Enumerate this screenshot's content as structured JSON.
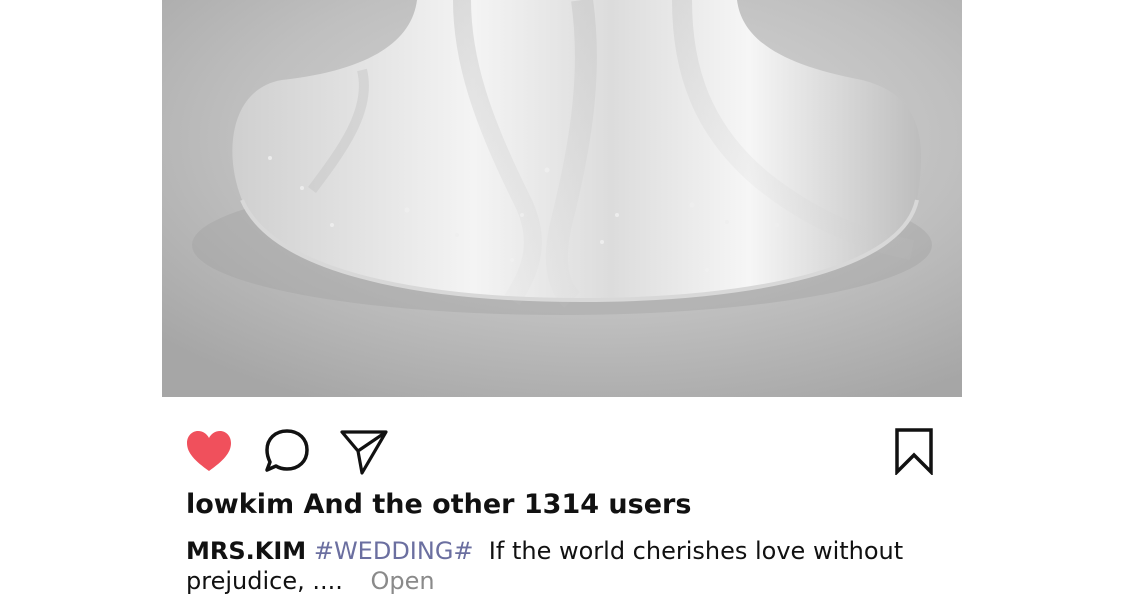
{
  "post": {
    "photo": {
      "description_icon": "wedding-dress-train-photo"
    },
    "actions": {
      "like": {
        "icon": "heart-icon",
        "color": "#f0505c",
        "liked": true
      },
      "comment": {
        "icon": "comment-icon"
      },
      "share": {
        "icon": "send-icon"
      },
      "save": {
        "icon": "bookmark-icon"
      }
    },
    "likes_text": "lowkim And the other 1314 users",
    "caption": {
      "username": "MRS.KIM",
      "hashtag": "#WEDDING#",
      "text": "If the world cherishes love without prejudice, ....",
      "more_label": "Open"
    }
  }
}
